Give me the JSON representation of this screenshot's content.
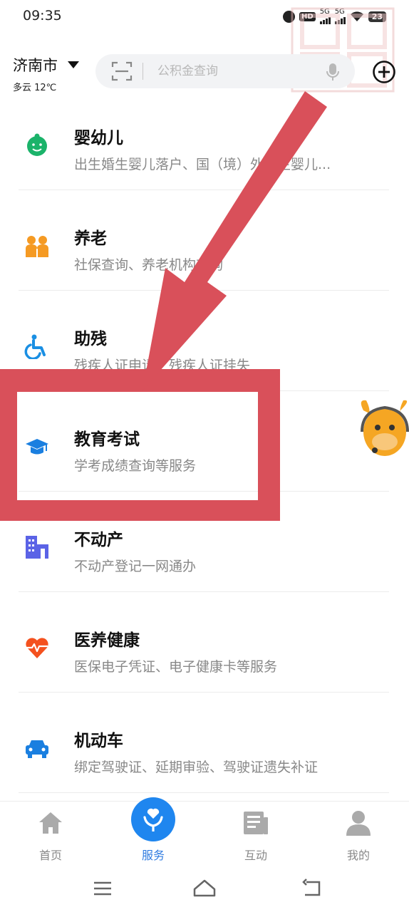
{
  "status_bar": {
    "time": "09:35",
    "hd_label": "HD",
    "net_1": "5G",
    "net_2": "5G",
    "battery": "23"
  },
  "header": {
    "city": "济南市",
    "weather": "多云 12℃",
    "search_placeholder": "公积金查询"
  },
  "services": [
    {
      "title": "婴幼儿",
      "subtitle": "出生婚生婴儿落户、国（境）外出生婴儿...",
      "icon": "baby-face-icon",
      "color": "#1bb36a"
    },
    {
      "title": "养老",
      "subtitle": "社保查询、养老机构查询",
      "icon": "elderly-couple-icon",
      "color": "#f59a23"
    },
    {
      "title": "助残",
      "subtitle": "残疾人证申请、残疾人证挂失",
      "icon": "wheelchair-icon",
      "color": "#1a8fe3"
    },
    {
      "title": "教育考试",
      "subtitle": "学考成绩查询等服务",
      "icon": "graduation-cap-icon",
      "color": "#1a7fe0"
    },
    {
      "title": "不动产",
      "subtitle": "不动产登记一网通办",
      "icon": "building-icon",
      "color": "#5b63e6"
    },
    {
      "title": "医养健康",
      "subtitle": "医保电子凭证、电子健康卡等服务",
      "icon": "heart-pulse-icon",
      "color": "#f4511e"
    },
    {
      "title": "机动车",
      "subtitle": "绑定驾驶证、延期审验、驾驶证遗失补证",
      "icon": "car-icon",
      "color": "#1a7fe0"
    }
  ],
  "bottom_nav": [
    {
      "label": "首页",
      "icon": "home-icon",
      "active": false
    },
    {
      "label": "服务",
      "icon": "service-heart-icon",
      "active": true
    },
    {
      "label": "互动",
      "icon": "news-icon",
      "active": false
    },
    {
      "label": "我的",
      "icon": "user-icon",
      "active": false
    }
  ],
  "colors": {
    "accent": "#1f86ef",
    "annotation": "#d9505a",
    "inactive_nav": "#aaaaaa"
  }
}
